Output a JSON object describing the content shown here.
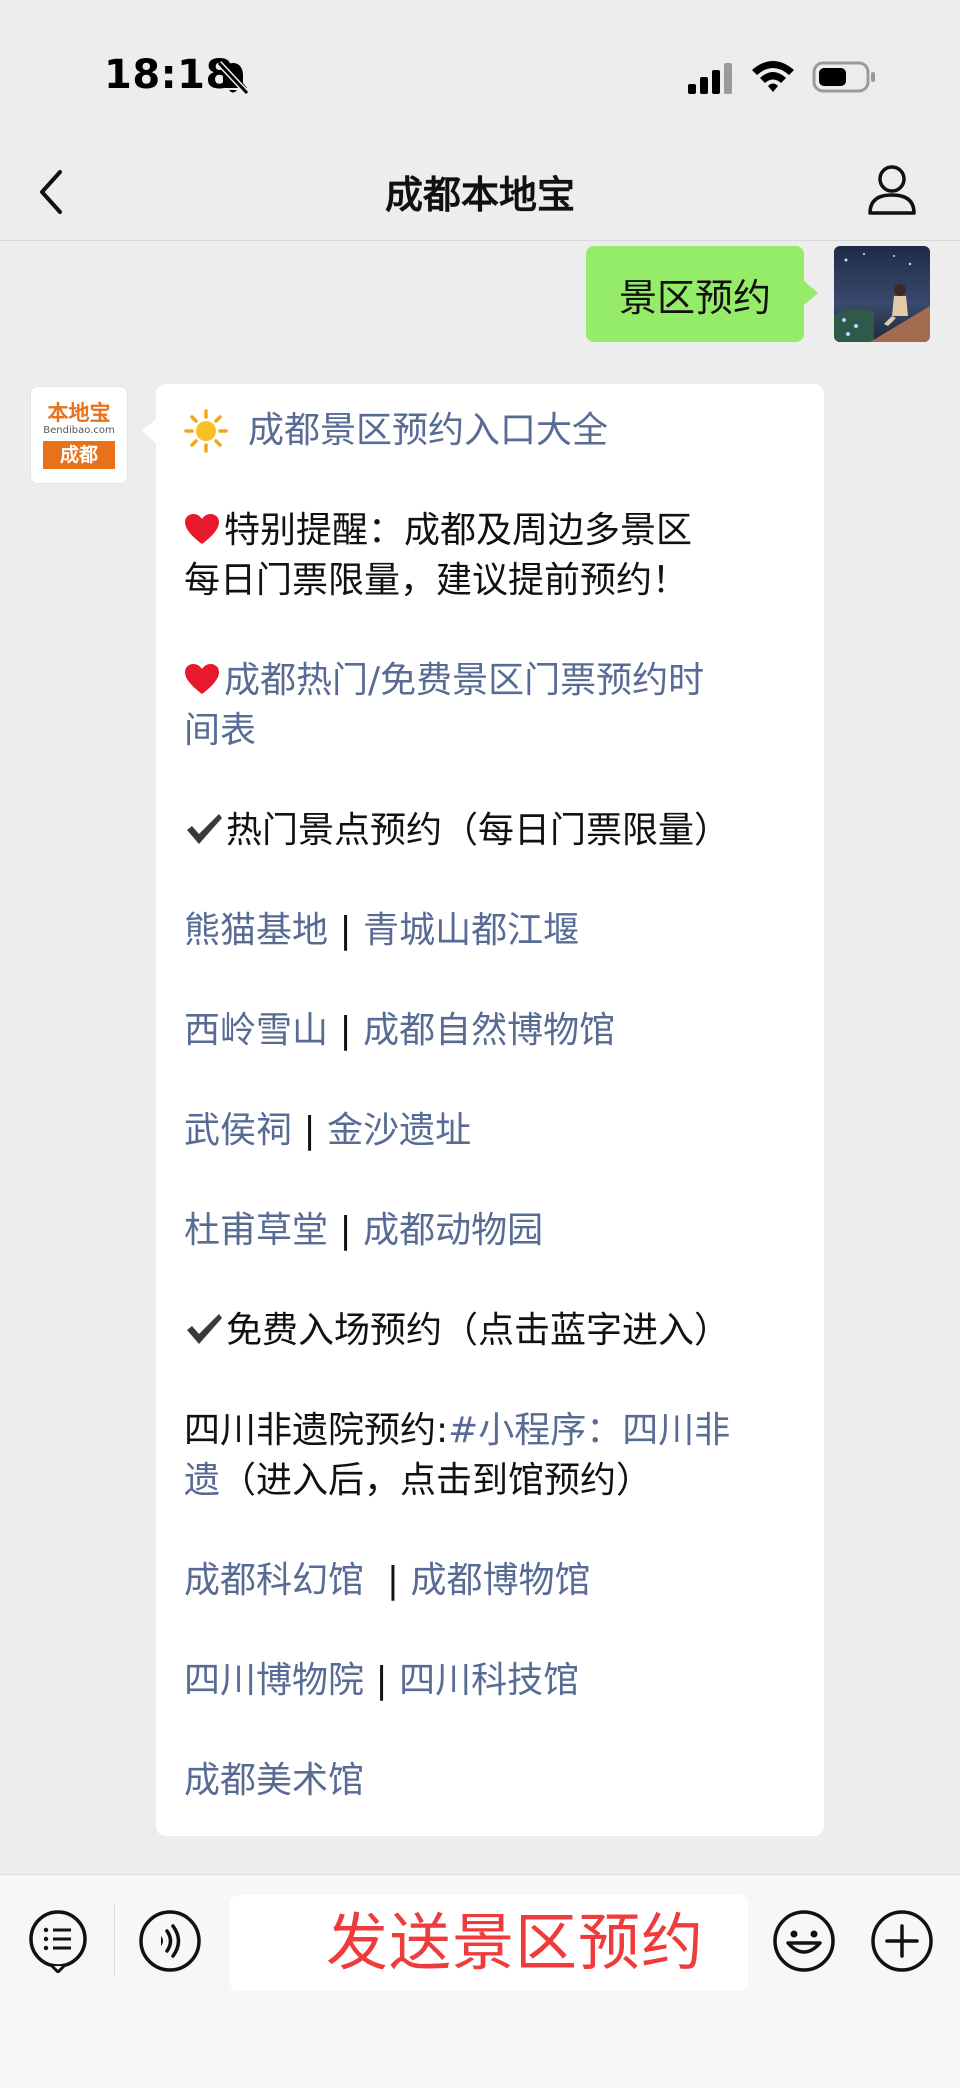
{
  "status_bar": {
    "time": "18:18"
  },
  "nav": {
    "title": "成都本地宝"
  },
  "outgoing": {
    "text": "景区预约"
  },
  "bot_logo": {
    "top": "本地宝",
    "domain": "Bendibao.com",
    "city": "成都"
  },
  "message": {
    "title": "成都景区预约入口大全",
    "reminder_1": "特别提醒：成都及周边多景区",
    "reminder_2": "每日门票限量，建议提前预约！",
    "schedule_1": "成都热门/免费景区门票预约时",
    "schedule_2": "间表",
    "hot_heading": "热门景点预约（每日门票限量）",
    "hot_rows": [
      {
        "a": "熊猫基地",
        "b": "青城山都江堰"
      },
      {
        "a": "西岭雪山",
        "b": "成都自然博物馆"
      },
      {
        "a": "武侯祠",
        "b": "金沙遗址"
      },
      {
        "a": "杜甫草堂",
        "b": "成都动物园"
      }
    ],
    "free_heading": "免费入场预约（点击蓝字进入）",
    "feiyi_label": "四川非遗院预约:",
    "feiyi_link_1": "#小程序：四川非",
    "feiyi_link_2": "遗",
    "feiyi_note": "（进入后，点击到馆预约）",
    "free_rows": [
      {
        "a": "成都科幻馆",
        "b": "成都博物馆"
      },
      {
        "a": "四川博物院",
        "b": "四川科技馆"
      }
    ],
    "last": "成都美术馆",
    "separator": "|"
  },
  "overlay": {
    "text": "发送景区预约"
  },
  "colors": {
    "link": "#576b95",
    "bubble_out": "#95ec69",
    "overlay": "#ef3b3b",
    "background": "#ededed"
  },
  "icons": [
    "bell-slash-icon",
    "signal-icon",
    "wifi-icon",
    "battery-icon",
    "back-icon",
    "person-icon",
    "sun-icon",
    "heart-icon",
    "check-icon",
    "menu-icon",
    "voice-icon",
    "emoji-icon",
    "plus-icon"
  ]
}
